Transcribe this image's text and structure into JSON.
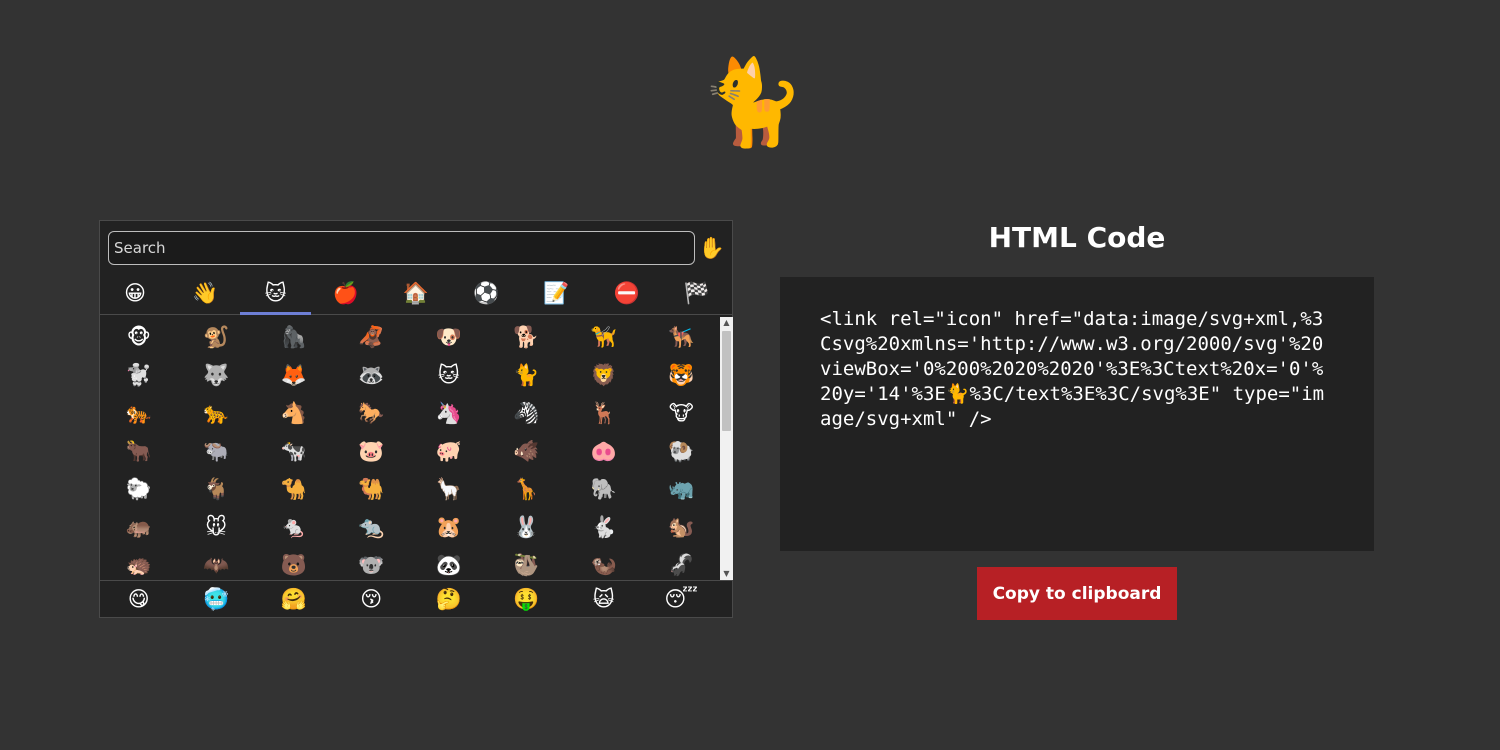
{
  "hero": {
    "emoji": "🐈"
  },
  "picker": {
    "search": {
      "placeholder": "Search",
      "value": ""
    },
    "skin_tone": "✋",
    "tabs": [
      {
        "emoji": "😀",
        "name": "smileys"
      },
      {
        "emoji": "👋",
        "name": "people"
      },
      {
        "emoji": "🐱",
        "name": "animals",
        "active": true
      },
      {
        "emoji": "🍎",
        "name": "food"
      },
      {
        "emoji": "🏠",
        "name": "travel"
      },
      {
        "emoji": "⚽",
        "name": "activities"
      },
      {
        "emoji": "📝",
        "name": "objects"
      },
      {
        "emoji": "⛔",
        "name": "symbols"
      },
      {
        "emoji": "🏁",
        "name": "flags"
      }
    ],
    "grid": [
      [
        "🐵",
        "🐒",
        "🦍",
        "🦧",
        "🐶",
        "🐕",
        "🦮",
        "🐕‍🦺"
      ],
      [
        "🐩",
        "🐺",
        "🦊",
        "🦝",
        "🐱",
        "🐈",
        "🦁",
        "🐯"
      ],
      [
        "🐅",
        "🐆",
        "🐴",
        "🐎",
        "🦄",
        "🦓",
        "🦌",
        "🐮"
      ],
      [
        "🐂",
        "🐃",
        "🐄",
        "🐷",
        "🐖",
        "🐗",
        "🐽",
        "🐏"
      ],
      [
        "🐑",
        "🐐",
        "🐪",
        "🐫",
        "🦙",
        "🦒",
        "🐘",
        "🦏"
      ],
      [
        "🦛",
        "🐭",
        "🐁",
        "🐀",
        "🐹",
        "🐰",
        "🐇",
        "🐿️"
      ],
      [
        "🦔",
        "🦇",
        "🐻",
        "🐨",
        "🐼",
        "🦥",
        "🦦",
        "🦨"
      ]
    ],
    "recent": [
      "😋",
      "🥶",
      "🤗",
      "😚",
      "🤔",
      "🤑",
      "🙀",
      "😴"
    ]
  },
  "code": {
    "title": "HTML Code",
    "snippet": "<link rel=\"icon\" href=\"data:image/svg+xml,%3Csvg%20xmlns='http://www.w3.org/2000/svg'%20viewBox='0%200%2020%2020'%3E%3Ctext%20x='0'%20y='14'%3E🐈%3C/text%3E%3C/svg%3E\" type=\"image/svg+xml\" />",
    "copy_label": "Copy to clipboard"
  },
  "colors": {
    "background": "#333333",
    "panel": "#222222",
    "tab_indicator": "#6e7fd6",
    "button": "#b72025"
  }
}
